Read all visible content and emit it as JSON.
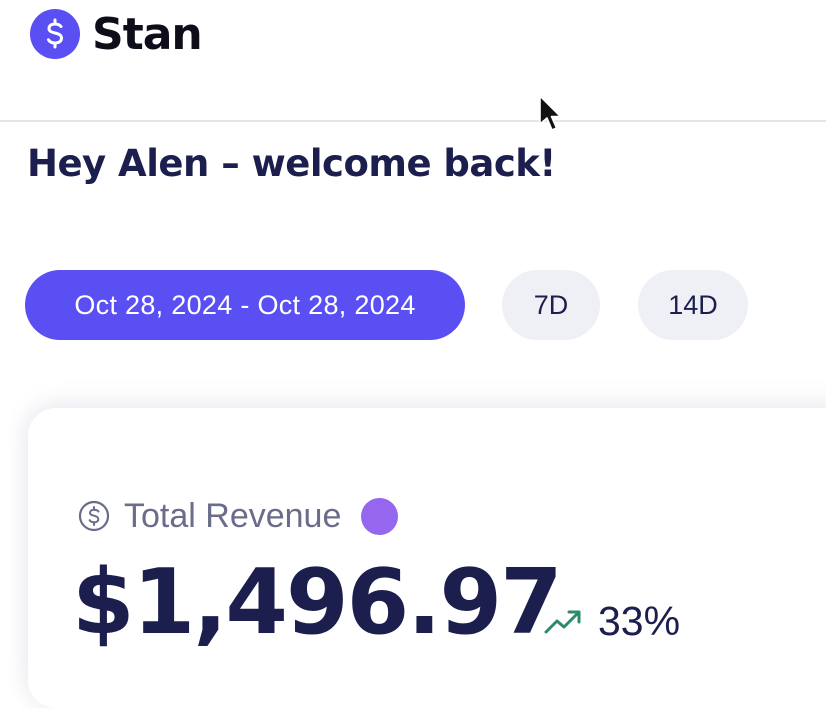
{
  "brand": {
    "name": "Stan",
    "logo_icon": "dollar-icon",
    "accent": "#5a4ff3"
  },
  "greeting": "Hey Alen – welcome back!",
  "filters": {
    "date_range": "Oct 28, 2024 - Oct 28, 2024",
    "chips": [
      "7D",
      "14D"
    ]
  },
  "revenue": {
    "label_icon": "dollar-circle-icon",
    "label": "Total Revenue",
    "info_dot_color": "#9566ee",
    "amount": "$1,496.97",
    "trend_icon": "trend-up-icon",
    "trend_color": "#2e8a68",
    "change": "33%"
  }
}
